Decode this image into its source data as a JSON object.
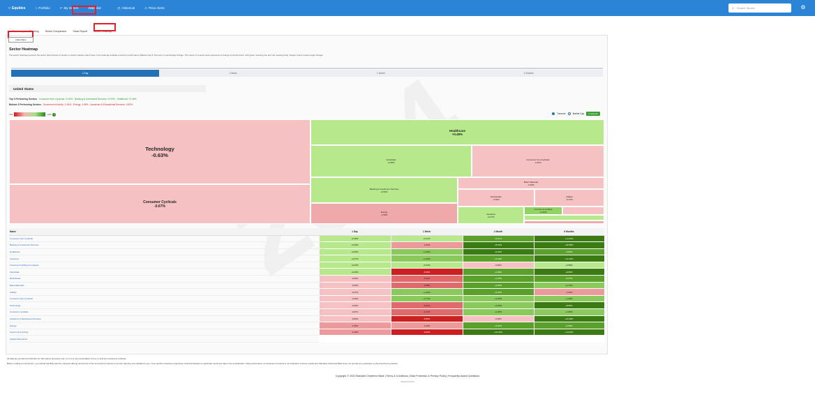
{
  "topbar": {
    "logo": "Equities",
    "items": [
      "Portfolio",
      "My Orders",
      "Watchlist",
      "Historical",
      "Price Alerts"
    ],
    "search_placeholder": "Search Stocks"
  },
  "subtabs": [
    "Summary",
    "Ranking",
    "Sector Comparison",
    "Stock Report",
    "Sector Heatmap"
  ],
  "button_label": "Hide Filters",
  "heatmap": {
    "title": "Sector Heatmap",
    "description": "The sector heatmap presents the sector performance of stocks in certain markets. Each area in the heatmap indicate a sector's performance (Market Cap & Turnover) in percentage change. The colour of a sector area represents a change of performance, with green meaning rise and red meaning drop. Deeper colour means larger change."
  },
  "periods": [
    "1 Day",
    "1 Week",
    "1 Month",
    "6 Months"
  ],
  "country": "United States",
  "top3_label": "Top 3 Performing Sectors",
  "top3": [
    "Consumer Non-Cyclicals +0.28%",
    "Banking & Investment Services +0.93%",
    "Healthcare +0.46%"
  ],
  "bottom3_label": "Bottom 3 Performing Sectors",
  "bottom3": [
    "Government Activity -1.60%",
    "Energy -1.55%",
    "Academic & Educational Services -0.83%"
  ],
  "legend": {
    "left": "-1%",
    "mid": "Performance",
    "right": "+1%"
  },
  "options": {
    "turnover": "Turnover",
    "marketcap": "Market Cap",
    "refresh": "Refresh"
  },
  "tree": [
    {
      "name": "Technology",
      "value": "-0.63%"
    },
    {
      "name": "Consumer Cyclicals",
      "value": "-0.67%"
    },
    {
      "name": "Healthcare",
      "value": "+0.49%"
    },
    {
      "name": "Industrials",
      "value": "+0.35%"
    },
    {
      "name": "Consumer Non-Cyclicals",
      "value": "-0.40%"
    },
    {
      "name": "Banking & Investment Services",
      "value": "+0.93%"
    },
    {
      "name": "Basic Materials",
      "value": "-0.63%"
    },
    {
      "name": "Real Estate",
      "value": "-0.60%"
    },
    {
      "name": "Utilities",
      "value": "-0.27%"
    },
    {
      "name": "Energy",
      "value": "-1.55%"
    },
    {
      "name": "Insurance",
      "value": "+0.47%"
    },
    {
      "name": "Investment Holding",
      "value": "+0.30%"
    }
  ],
  "table": {
    "headers": [
      "Name",
      "1 Day",
      "1 Week",
      "1 Month",
      "6 Months"
    ],
    "rows": [
      [
        "Consumer Non-Cyclicals",
        "+0.28%",
        "+0.11%",
        "+5.67%",
        "+14.22%"
      ],
      [
        "Banking & Investment Services",
        "+0.93%",
        "-1.93%",
        "+8.23%",
        "+18.35%"
      ],
      [
        "Healthcare",
        "+0.46%",
        "+1.46%",
        "+9.39%",
        "+5.80%"
      ],
      [
        "Insurance",
        "+0.47%",
        "+1.46%",
        "+5.28%",
        "+12.16%"
      ],
      [
        "Investment Holding Companies",
        "+0.30%",
        "+0.34%",
        "-0.84%",
        "+0.58%"
      ],
      [
        "Industrials",
        "+0.35%",
        "-6.05%",
        "+3.98%",
        "+8.85%"
      ],
      [
        "Real Estate",
        "-0.60%",
        "-5.11%",
        "+4.25%",
        "+5.47%"
      ],
      [
        "Basic Materials",
        "-0.63%",
        "-4.68%",
        "+3.05%",
        "+2.76%"
      ],
      [
        "Utilities",
        "-0.27%",
        "+1.40%",
        "+5.45%",
        "-1.23%"
      ],
      [
        "Consumer Non-Cyclicals",
        "-0.40%",
        "+2.71%",
        "+1.93%",
        "+1.28%"
      ],
      [
        "Technology",
        "-0.63%",
        "-5.07%",
        "+1.63%",
        "+8.95%"
      ],
      [
        "Consumer Cyclicals",
        "-0.67%",
        "-4.47%",
        "+2.35%",
        "+1.95%"
      ],
      [
        "Academic & Educational Services",
        "-0.83%",
        "-6.83%",
        "-0.18%",
        "+20.28%"
      ],
      [
        "Energy",
        "-1.55%",
        "-1.23%",
        "+3.92%",
        "+3.59%"
      ],
      [
        "Government Activity",
        "-1.60%",
        "-9.03%",
        "+10.23%",
        "+14.53%"
      ],
      [
        "Applied Resources",
        "",
        "",
        "",
        ""
      ]
    ]
  },
  "foot": {
    "note": "All data are provided by Refinitiv for information purposes only. It is not a recommendation to buy or sell any investment products.",
    "disclaimer": "Before making an investment, you should carefully read the relevant offering documents of the investment products to ensure that they are suitable for you. Your specific investment objectives, financial situation or particular needs are taken into consideration. Past performance of investment products is not indicative of future results and Standard Chartered Bank does not provide any guarantee to the investment products.",
    "copyright": "Copyright © 2024 Standard Chartered Bank | Terms & Conditions | Data Protection & Privacy Policy | Frequently Asked Questions",
    "version": "Version 6.3.0.671"
  },
  "watermark": "2024"
}
